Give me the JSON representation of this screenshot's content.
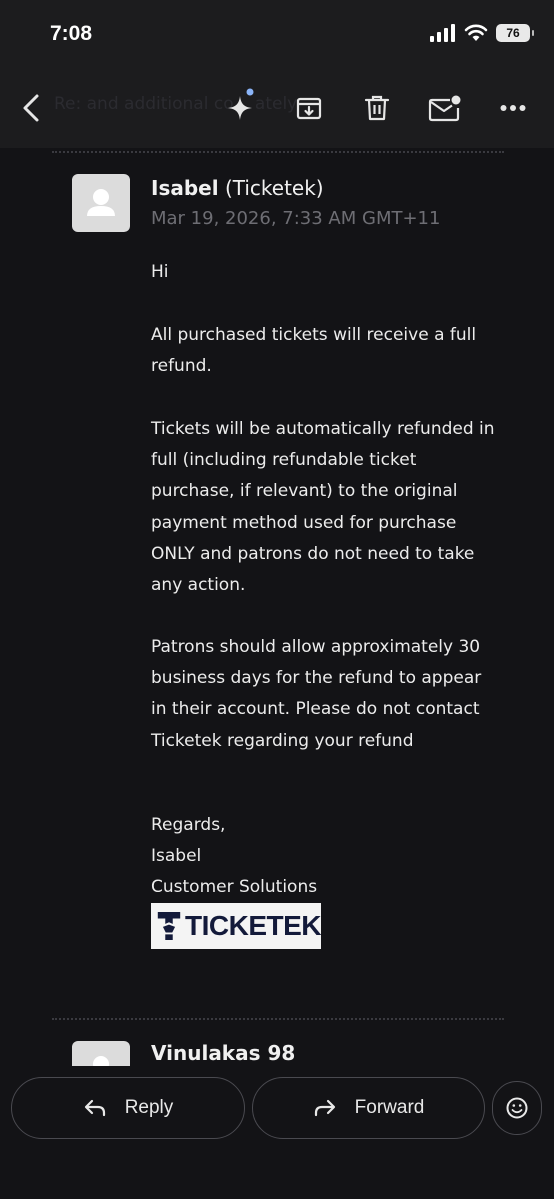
{
  "status_bar": {
    "time": "7:08",
    "battery": "76",
    "icons": [
      "cellular-signal-icon",
      "wifi-icon",
      "battery-icon"
    ]
  },
  "toolbar": {
    "subject_ghost": "Re: and additional co... ately",
    "buttons": [
      "back-icon",
      "gemini-sparkle-icon",
      "archive-icon",
      "delete-icon",
      "mark-unread-icon",
      "more-icon"
    ],
    "accent_dot_color": "#8ab4f8"
  },
  "message": {
    "sender_name": "Isabel",
    "sender_org": "(Ticketek)",
    "date": "Mar 19, 2026, 7:33 AM GMT+11",
    "body": {
      "greeting": "Hi",
      "p1": [
        "All purchased tickets will receive a full",
        "refund."
      ],
      "p2": [
        "Tickets will be automatically refunded in",
        "full (including refundable ticket",
        "purchase, if relevant) to the original",
        "payment method used for purchase",
        "ONLY and patrons do not need to take",
        "any action."
      ],
      "p3": [
        "Patrons should allow approximately 30",
        "business days for the refund to appear",
        "in their account. Please do not contact",
        "Ticketek regarding your refund"
      ],
      "signoff": [
        "Regards,",
        "Isabel",
        "Customer Solutions"
      ]
    },
    "logo_text": "TICKETEK"
  },
  "next_message": {
    "sender_name": "Vinulakas 98"
  },
  "bottom_bar": {
    "reply_label": "Reply",
    "forward_label": "Forward"
  },
  "colors": {
    "background": "#131316",
    "toolbar": "#1c1c1e",
    "date_text": "#6e6e74",
    "logo_navy": "#131a3a"
  }
}
